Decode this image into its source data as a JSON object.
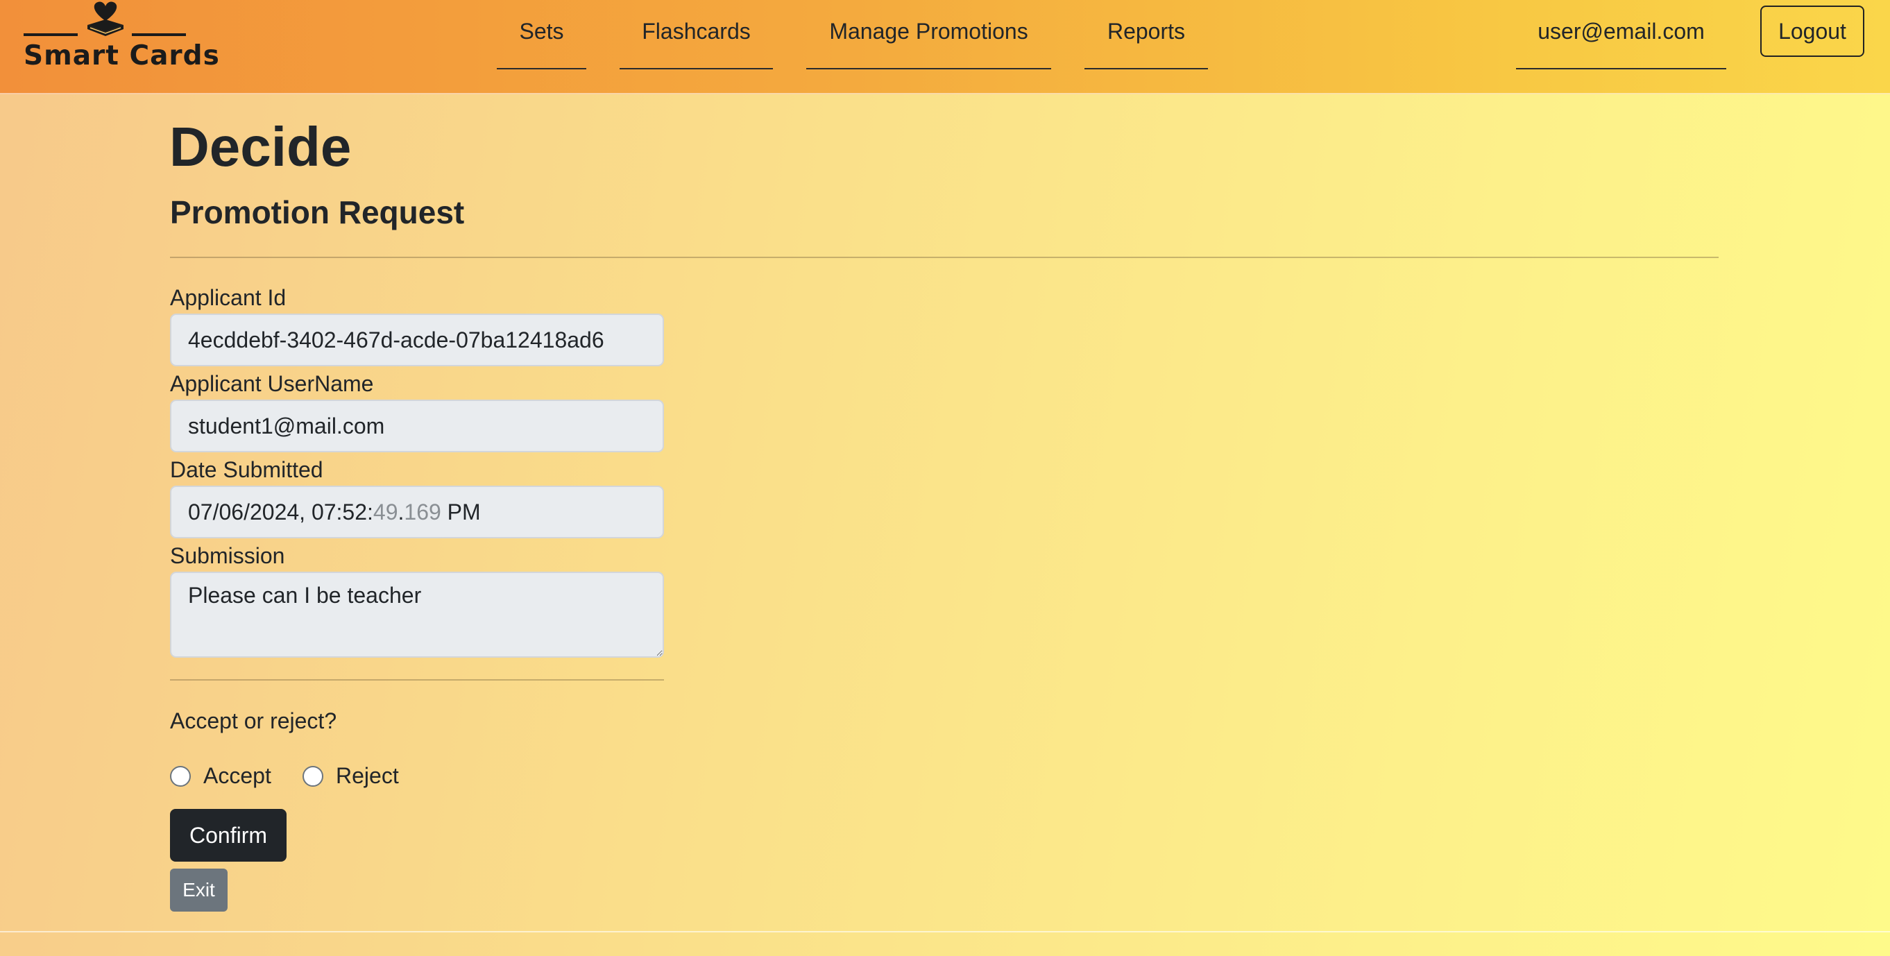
{
  "brand": {
    "name": "Smart Cards",
    "icon": "book-heart-icon"
  },
  "nav": {
    "items": [
      {
        "label": "Sets"
      },
      {
        "label": "Flashcards"
      },
      {
        "label": "Manage Promotions"
      },
      {
        "label": "Reports"
      }
    ],
    "user_email": "user@email.com",
    "logout_label": "Logout"
  },
  "page": {
    "title": "Decide",
    "subtitle": "Promotion Request"
  },
  "form": {
    "applicant_id": {
      "label": "Applicant Id",
      "value": "4ecddebf-3402-467d-acde-07ba12418ad6"
    },
    "applicant_username": {
      "label": "Applicant UserName",
      "value": "student1@mail.com"
    },
    "date_submitted": {
      "label": "Date Submitted",
      "date": "07/06/2024, 07:52:",
      "seconds": "49",
      "sep": ".",
      "millis": "169",
      "ampm": " PM"
    },
    "submission": {
      "label": "Submission",
      "value": "Please can I be teacher"
    },
    "question": "Accept or reject?",
    "options": [
      {
        "label": "Accept",
        "selected": false
      },
      {
        "label": "Reject",
        "selected": false
      }
    ],
    "confirm_label": "Confirm",
    "exit_label": "Exit"
  },
  "colors": {
    "header_start": "#f2903a",
    "header_end": "#fad64a",
    "primary_button": "#212529",
    "secondary_button": "#6c757d",
    "input_bg": "#e9ecef"
  }
}
